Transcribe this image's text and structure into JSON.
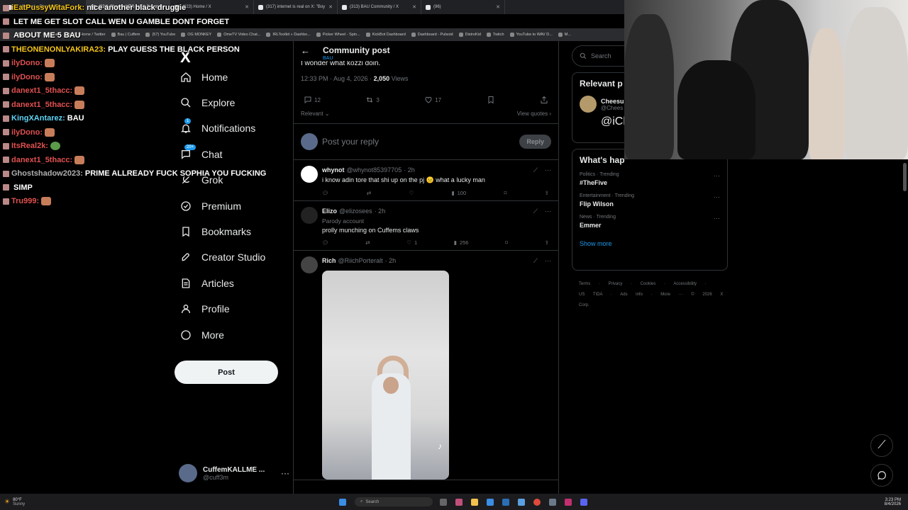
{
  "tabs": [
    {
      "label": "Iz | Sexual » BlossomUp",
      "active": false
    },
    {
      "label": "(324) CheesurYTG on X: \"I wonder",
      "active": true
    },
    {
      "label": "(323) Home / X",
      "active": false
    },
    {
      "label": "(317) internet is real on X: \"Boy",
      "active": false
    },
    {
      "label": "(313) BAU Community / X",
      "active": false
    },
    {
      "label": "(96)",
      "active": false
    }
  ],
  "bookmarks": [
    "Kick",
    "Instagram",
    "(12) Home / Twitter",
    "Bau | Cuffem",
    "(57) YouTube",
    "OG MONKEY",
    "OmeTV Video Chat...",
    "IRLToolkit » Dashbo...",
    "Picker Wheel - Spin...",
    "KickBot Dashboard",
    "Dashboard - Pulsoid",
    "DistroKid",
    "Twitch",
    "YouTube to WAV D...",
    "M..."
  ],
  "chat": [
    {
      "user": "iEatPussyWitaFork:",
      "msg": "nice another black druggie",
      "color": "#f5c518"
    },
    {
      "user": "",
      "msg": "LET ME GET SLOT CALL WEN U GAMBLE DONT FORGET",
      "color": "#e05050"
    },
    {
      "user": "",
      "msg": "ABOUT ME 5 BAU",
      "color": "#ffffff"
    },
    {
      "user": "THEONENONLYAKIRA23:",
      "msg": "PLAY GUESS THE BLACK PERSON",
      "color": "#f5c518"
    },
    {
      "user": "ilyDono:",
      "msg": "",
      "color": "#e05050"
    },
    {
      "user": "ilyDono:",
      "msg": "",
      "color": "#e05050"
    },
    {
      "user": "danext1_5thacc:",
      "msg": "",
      "color": "#e05050"
    },
    {
      "user": "danext1_5thacc:",
      "msg": "",
      "color": "#e05050"
    },
    {
      "user": "KingXAntarez:",
      "msg": "BAU",
      "color": "#5fd3f5"
    },
    {
      "user": "ilyDono:",
      "msg": "",
      "color": "#e05050"
    },
    {
      "user": "ItsReal2k:",
      "msg": "",
      "color": "#e05050"
    },
    {
      "user": "danext1_5thacc:",
      "msg": "",
      "color": "#e05050"
    },
    {
      "user": "Ghostshadow2023:",
      "msg": "PRIME ALLREADY FUCK SOPHIA YOU FUCKING",
      "color": "#b0b0b0"
    },
    {
      "user": "",
      "msg": "SIMP",
      "color": "#ffffff"
    },
    {
      "user": "Tru999:",
      "msg": "",
      "color": "#e05050"
    }
  ],
  "nav": {
    "logo": "X",
    "items": [
      {
        "label": "Home",
        "icon": "home-icon"
      },
      {
        "label": "Explore",
        "icon": "search-icon"
      },
      {
        "label": "Notifications",
        "icon": "bell-icon",
        "badge": "1"
      },
      {
        "label": "Chat",
        "icon": "chat-icon",
        "badge": "20+"
      },
      {
        "label": "Grok",
        "icon": "grok-icon"
      },
      {
        "label": "Premium",
        "icon": "premium-icon"
      },
      {
        "label": "Bookmarks",
        "icon": "bookmark-icon"
      },
      {
        "label": "Creator Studio",
        "icon": "rocket-icon"
      },
      {
        "label": "Articles",
        "icon": "articles-icon"
      },
      {
        "label": "Profile",
        "icon": "person-icon"
      },
      {
        "label": "More",
        "icon": "more-circle-icon"
      }
    ],
    "post": "Post",
    "account": {
      "name": "CuffemKALLME ...",
      "handle": "@cuff3m"
    }
  },
  "main": {
    "title": "Community post",
    "subtitle": "BAU",
    "cut_text": "I wonder what kozzi doin.",
    "time": "12:33 PM · Aug 4, 2026 · ",
    "views_num": "2,050",
    "views_label": " Views",
    "counts": {
      "replies": "12",
      "reposts": "3",
      "likes": "17"
    },
    "relevant": "Relevant",
    "view_quotes": "View quotes",
    "reply_placeholder": "Post your reply",
    "reply_btn": "Reply",
    "tweets": [
      {
        "name": "whynot",
        "handle": "@whynot85397705",
        "time": "· 2h",
        "text": "i know adin tore that shi up on the pj 😐 what a lucky man",
        "parody": "",
        "replies": "",
        "reposts": "",
        "likes": "",
        "views": "100"
      },
      {
        "name": "Elizo",
        "handle": "@elizosees",
        "time": "· 2h",
        "text": "prolly munching on Cuffems claws",
        "parody": "Parody account",
        "replies": "",
        "reposts": "",
        "likes": "1",
        "views": "256"
      },
      {
        "name": "Rich",
        "handle": "@RiichPorteralt",
        "time": "· 2h",
        "text": "",
        "parody": "",
        "replies": "",
        "reposts": "",
        "likes": "",
        "views": ""
      }
    ]
  },
  "right": {
    "search": "Search",
    "relevant_title": "Relevant p",
    "rel_name": "Cheesu",
    "rel_handle": "@Chees",
    "rel_bio": "@iChee",
    "happening": "What's hap",
    "trends": [
      {
        "cat": "Politics · Trending",
        "name": "#TheFive"
      },
      {
        "cat": "Entertainment · Trending",
        "name": "Flip Wilson"
      },
      {
        "cat": "News · Trending",
        "name": "Emmer"
      }
    ],
    "show_more": "Show more",
    "footer1": "Terms · Privacy · Cookies · Accessibility ·",
    "footer2": "US TIDA · Ads info · More ··· © 2026 X Corp."
  },
  "taskbar": {
    "weather": "80°F",
    "weather_sub": "Sunny",
    "search": "Search",
    "time": "3:23 PM",
    "date": "8/4/2026"
  },
  "colors": {
    "accent": "#1d9bf0",
    "bg": "#000000"
  }
}
